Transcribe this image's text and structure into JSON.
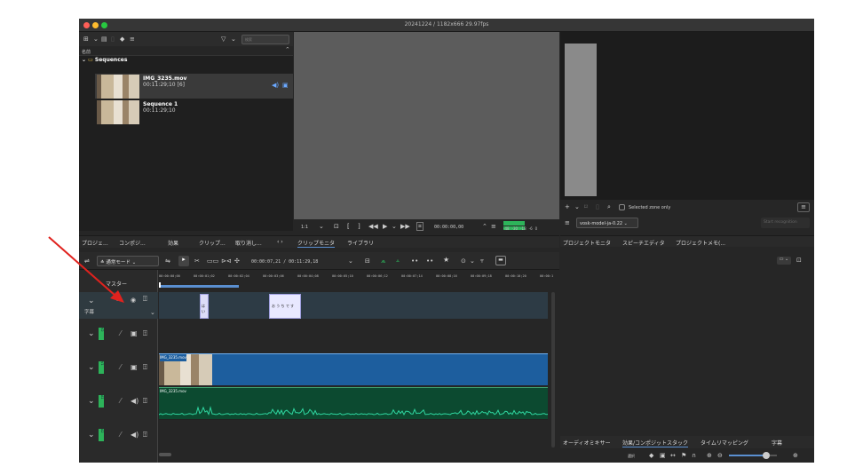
{
  "window": {
    "title": "20241224 / 1182x666 29.97fps"
  },
  "bin": {
    "search_placeholder": "検索",
    "column_name": "名前",
    "folder": "Sequences",
    "clips": [
      {
        "name": "IMG_3235.mov",
        "duration": "00:11:29;10 [6]"
      },
      {
        "name": "Sequence 1",
        "duration": "00:11:29;10"
      }
    ]
  },
  "monitor": {
    "zoom": "1:1",
    "timecode": "00:00:00,00",
    "audio_labels": [
      "-48",
      "-30",
      "-18",
      "-6",
      "0"
    ]
  },
  "left_tabs": [
    "プロジェ...",
    "コンポジ...",
    "効果",
    "クリップ...",
    "取り消し...",
    "クリップモニタ",
    "ライブラリ"
  ],
  "speech": {
    "selected_zone": "Selected zone only",
    "model": "vosk-model-ja-0.22",
    "start": "Start recognition"
  },
  "right_tabs": [
    "プロジェクトモニタ",
    "スピーチエディタ",
    "プロジェクトメモ(..."
  ],
  "timeline": {
    "mode": "通常モード",
    "position": "00:00:07,21 / 00:11:29,18",
    "master": "マスター",
    "subtitle_track": "字幕",
    "ruler": [
      "00:00:00;00",
      "00:00:01;02",
      "00:00:02;04",
      "00:00:03;06",
      "00:00:04;08",
      "00:00:05;10",
      "00:00:06;12",
      "00:00:07;14",
      "00:00:08;16",
      "00:00:09;18",
      "00:00:10;20",
      "00:00:1"
    ],
    "subtitles": [
      "はい",
      "お う ち で す"
    ],
    "tracks": [
      "V2",
      "V1",
      "A1",
      "A2"
    ],
    "video_clip": "IMG_3235.mov",
    "audio_clip": "IMG_3235.mov"
  },
  "bottom_tabs": [
    "オーディオミキサー",
    "効果/コンポジットスタック",
    "タイムリマッピング",
    "字幕"
  ],
  "statusbar": {
    "select": "選択"
  },
  "colors": {
    "accent": "#5a8fd0",
    "video_clip": "#1d5e9e",
    "audio_clip": "#0c4a30",
    "subtitle_clip": "#e0e0ff",
    "track_green": "#2db35a"
  }
}
